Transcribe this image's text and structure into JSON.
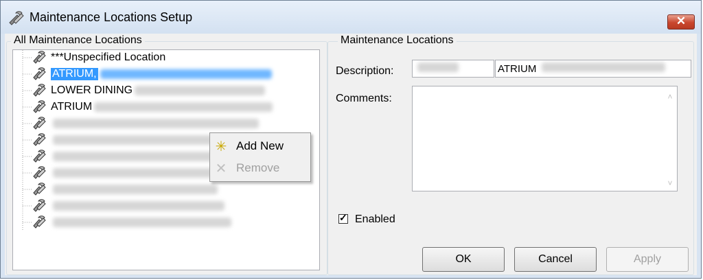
{
  "window": {
    "title": "Maintenance Locations Setup",
    "close_glyph": "✕"
  },
  "left_group": {
    "label": "All Maintenance Locations"
  },
  "tree": {
    "items": [
      {
        "text": "***Unspecified Location",
        "icon": "location-icon"
      },
      {
        "text": "ATRIUM,",
        "icon": "location-icon",
        "selected": true
      },
      {
        "text": "LOWER DINING",
        "icon": "location-icon"
      },
      {
        "text": "ATRIUM",
        "icon": "location-icon"
      },
      {
        "text": "",
        "icon": "location-icon"
      },
      {
        "text": "",
        "icon": "location-icon"
      },
      {
        "text": "",
        "icon": "location-icon"
      },
      {
        "text": "",
        "icon": "location-icon"
      },
      {
        "text": "",
        "icon": "location-icon"
      },
      {
        "text": "",
        "icon": "location-icon"
      },
      {
        "text": "",
        "icon": "location-icon"
      }
    ]
  },
  "context_menu": {
    "add_new": {
      "label": "Add New",
      "icon": "asterisk-icon",
      "glyph": "✳"
    },
    "remove": {
      "label": "Remove",
      "icon": "remove-x-icon",
      "glyph": "✕"
    }
  },
  "right_group": {
    "label": "Maintenance Locations"
  },
  "form": {
    "description_label": "Description:",
    "description_code": "",
    "description_value": "ATRIUM",
    "comments_label": "Comments:",
    "comments_value": "",
    "enabled_label": "Enabled",
    "enabled_checked": true,
    "check_glyph": "✓"
  },
  "buttons": {
    "ok": "OK",
    "cancel": "Cancel",
    "apply": "Apply"
  },
  "colors": {
    "selection": "#3399ff",
    "close_button": "#c9472e",
    "title_bar": "#d3e1f1"
  }
}
